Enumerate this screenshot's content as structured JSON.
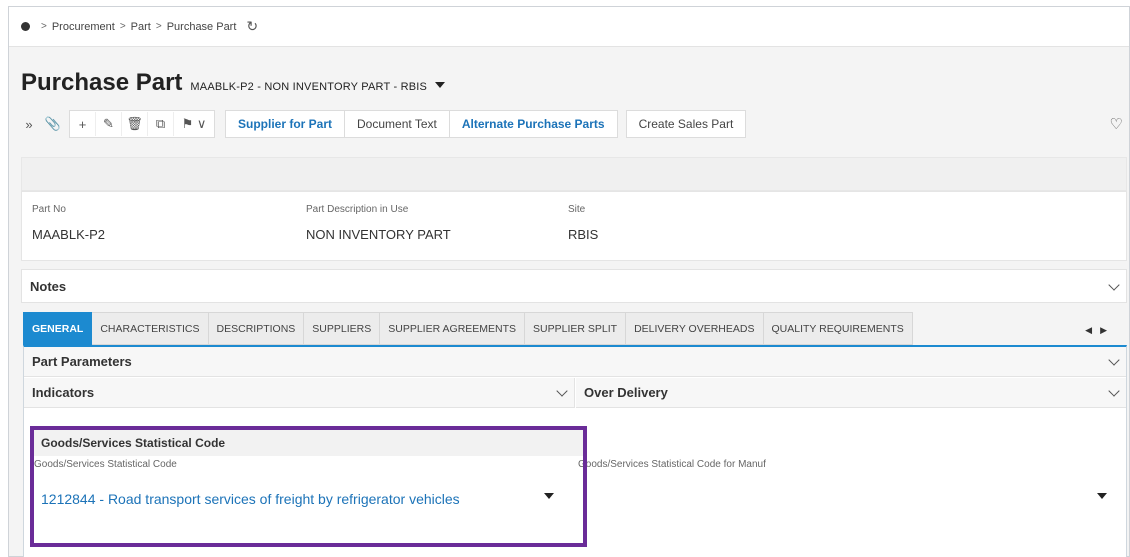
{
  "breadcrumb": {
    "items": [
      "Procurement",
      "Part",
      "Purchase Part"
    ]
  },
  "page": {
    "title": "Purchase Part",
    "subtitle": "MAABLK-P2 - NON INVENTORY PART - RBIS"
  },
  "toolbar": {
    "buttons": [
      "Supplier for Part",
      "Document Text",
      "Alternate Purchase Parts",
      "Create Sales Part"
    ]
  },
  "header": {
    "part_no_label": "Part No",
    "part_no_value": "MAABLK-P2",
    "desc_label": "Part Description in Use",
    "desc_value": "NON INVENTORY PART",
    "site_label": "Site",
    "site_value": "RBIS"
  },
  "notes": {
    "label": "Notes"
  },
  "tabs": [
    "GENERAL",
    "CHARACTERISTICS",
    "DESCRIPTIONS",
    "SUPPLIERS",
    "SUPPLIER AGREEMENTS",
    "SUPPLIER SPLIT",
    "DELIVERY OVERHEADS",
    "QUALITY REQUIREMENTS"
  ],
  "active_tab": "GENERAL",
  "sections": {
    "part_parameters": "Part Parameters",
    "indicators": "Indicators",
    "over_delivery": "Over Delivery",
    "goods_services": "Goods/Services Statistical Code"
  },
  "goods_services": {
    "code_label": "Goods/Services Statistical Code",
    "code_value": "1212844 - Road transport services of freight by refrigerator vehicles",
    "manuf_label": "Goods/Services Statistical Code for Manuf",
    "manuf_value": ""
  },
  "colors": {
    "accent": "#1c8ad0",
    "link": "#1c73b8",
    "highlight": "#6a2c98"
  }
}
